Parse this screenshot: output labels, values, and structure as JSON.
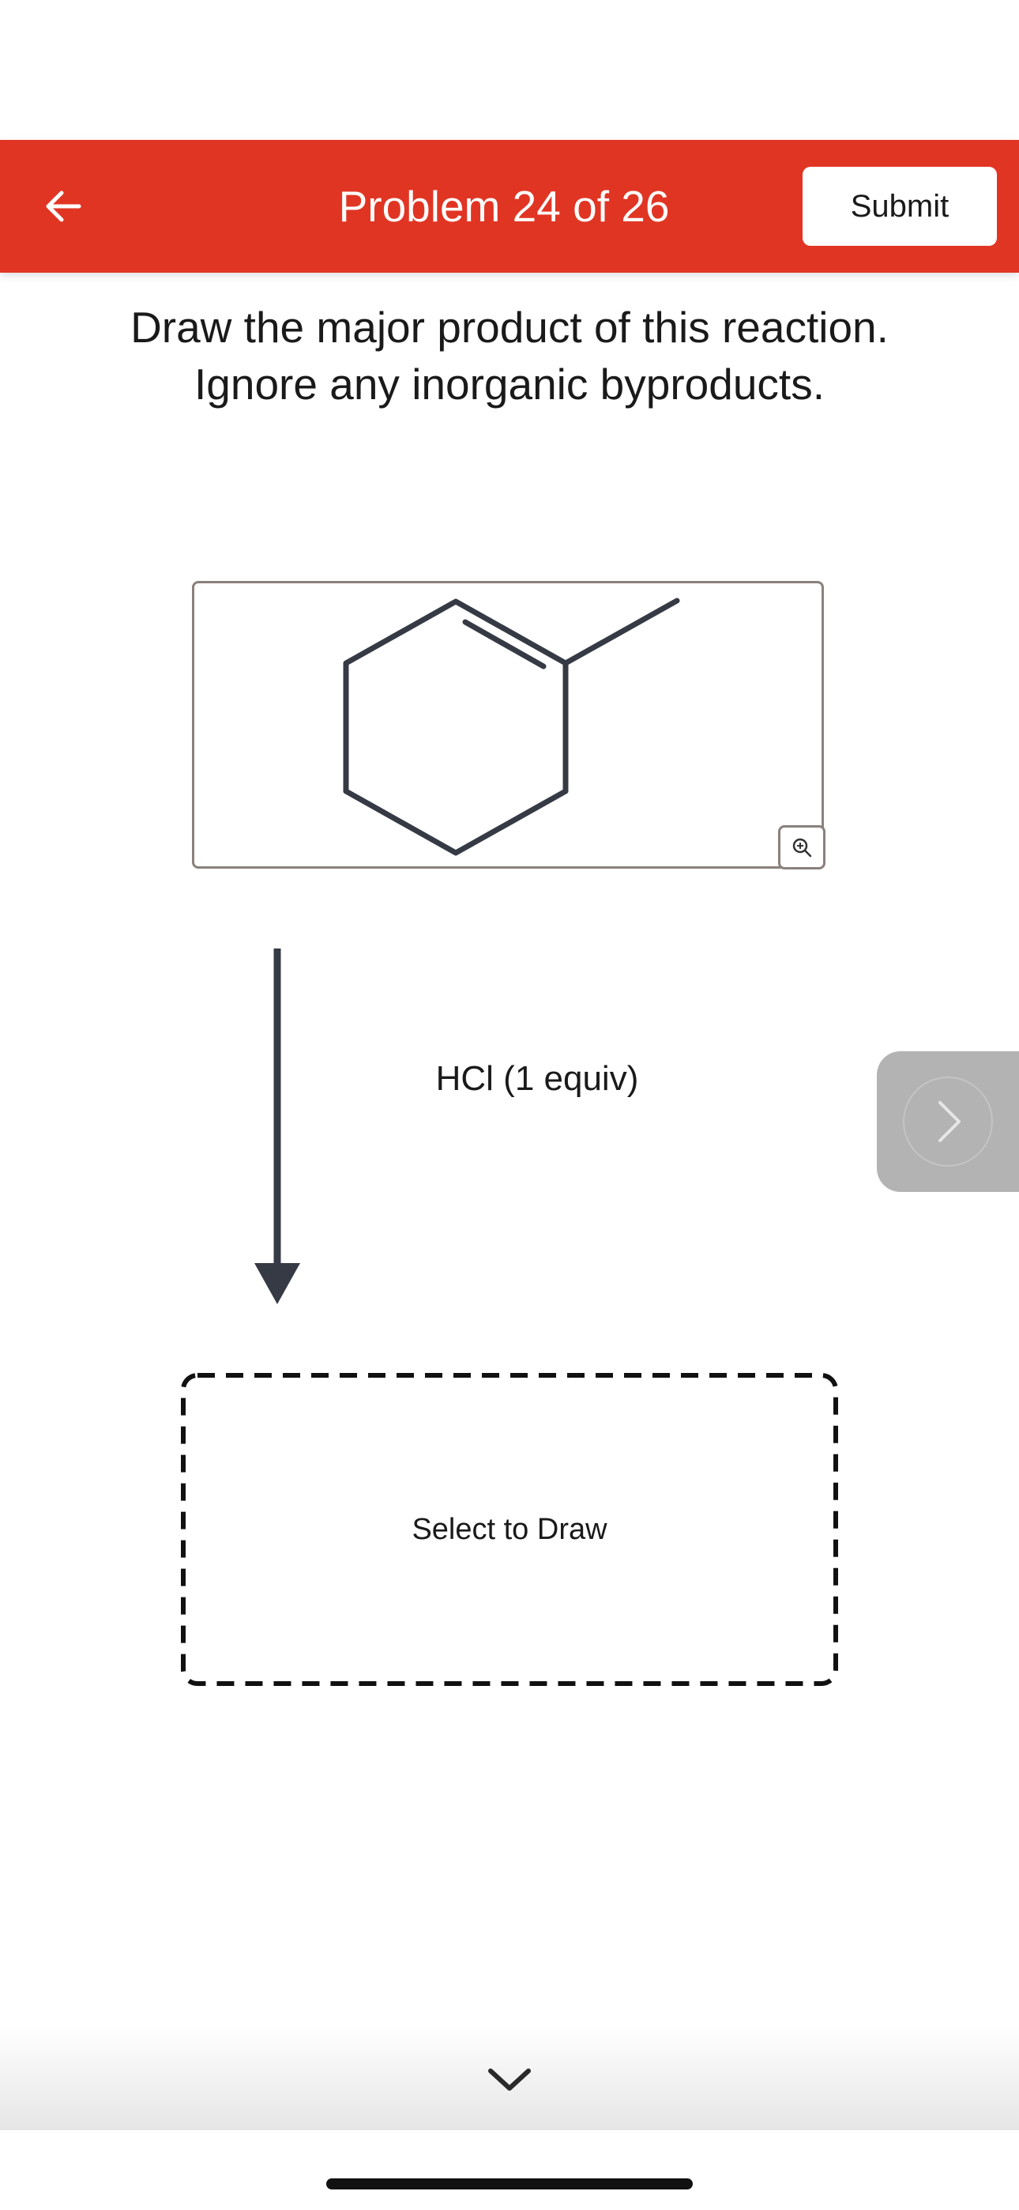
{
  "header": {
    "title": "Problem 24 of 26",
    "submit_label": "Submit",
    "back_icon": "arrow-left-icon"
  },
  "question": {
    "line1": "Draw the major product of this reaction.",
    "line2": "Ignore any inorganic byproducts."
  },
  "reaction": {
    "reactant_icon": "1-methylcyclohexene-structure",
    "zoom_icon": "zoom-in-icon",
    "reagent": "HCl (1 equiv)"
  },
  "answer": {
    "placeholder": "Select to Draw"
  },
  "navigation": {
    "next_icon": "chevron-right-icon",
    "expand_icon": "chevron-down-icon"
  },
  "colors": {
    "header_bg": "#e13524",
    "structure": "#353a44",
    "next_button_bg": "#b3b3b3"
  }
}
